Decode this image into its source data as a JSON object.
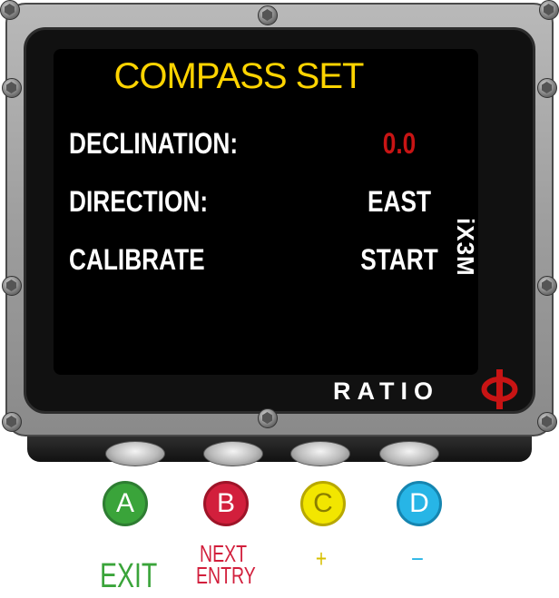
{
  "screen": {
    "title": "COMPASS SET",
    "rows": [
      {
        "label": "DECLINATION:",
        "value": "0.0",
        "value_color": "#c81414"
      },
      {
        "label": "DIRECTION:",
        "value": "EAST",
        "value_color": "#ffffff"
      },
      {
        "label": "CALIBRATE",
        "value": "START",
        "value_color": "#ffffff"
      }
    ]
  },
  "device": {
    "model": "iX3M",
    "brand": "RATIO",
    "logo_icon": "phi-logo-icon"
  },
  "buttons": [
    {
      "letter": "A",
      "label": "EXIT",
      "color": "#3aa43a"
    },
    {
      "letter": "B",
      "label_line1": "NEXT",
      "label_line2": "ENTRY",
      "color": "#d21f3c"
    },
    {
      "letter": "C",
      "label": "+",
      "color": "#f2e600"
    },
    {
      "letter": "D",
      "label": "–",
      "color": "#27b5e6"
    }
  ]
}
